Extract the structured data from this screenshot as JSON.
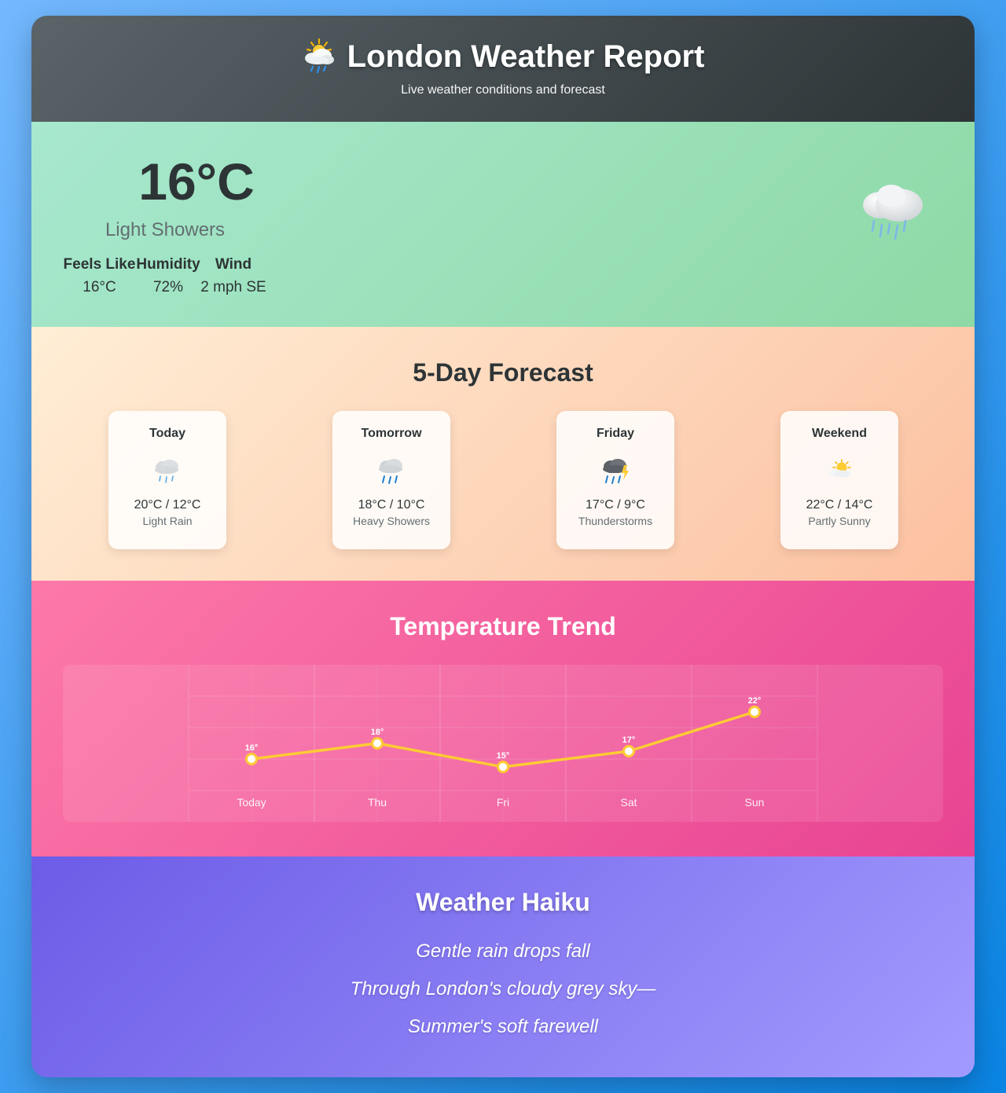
{
  "header": {
    "title": "London Weather Report",
    "subtitle": "Live weather conditions and forecast",
    "icon": "sun-behind-rain-cloud-icon"
  },
  "current": {
    "temperature": "16°C",
    "condition": "Light Showers",
    "icon": "rain-cloud-icon",
    "stats": [
      {
        "label": "Feels Like",
        "value": "16°C"
      },
      {
        "label": "Humidity",
        "value": "72%"
      },
      {
        "label": "Wind",
        "value": "2 mph SE"
      }
    ]
  },
  "forecast": {
    "title": "5-Day Forecast",
    "days": [
      {
        "name": "Today",
        "temp": "20°C / 12°C",
        "desc": "Light Rain",
        "icon": "rain-cloud-icon"
      },
      {
        "name": "Tomorrow",
        "temp": "18°C / 10°C",
        "desc": "Heavy Showers",
        "icon": "heavy-rain-cloud-icon"
      },
      {
        "name": "Friday",
        "temp": "17°C / 9°C",
        "desc": "Thunderstorms",
        "icon": "thunderstorm-icon"
      },
      {
        "name": "Weekend",
        "temp": "22°C / 14°C",
        "desc": "Partly Sunny",
        "icon": "partly-sunny-icon"
      }
    ]
  },
  "trend": {
    "title": "Temperature Trend"
  },
  "chart_data": {
    "type": "line",
    "categories": [
      "Today",
      "Thu",
      "Fri",
      "Sat",
      "Sun"
    ],
    "values": [
      16,
      18,
      15,
      17,
      22
    ],
    "point_labels": [
      "16°",
      "18°",
      "15°",
      "17°",
      "22°"
    ],
    "grid": true,
    "line_color": "#fdcb34"
  },
  "haiku": {
    "title": "Weather Haiku",
    "lines": [
      "Gentle rain drops fall",
      "Through London's cloudy grey sky—",
      "Summer's soft farewell"
    ]
  }
}
